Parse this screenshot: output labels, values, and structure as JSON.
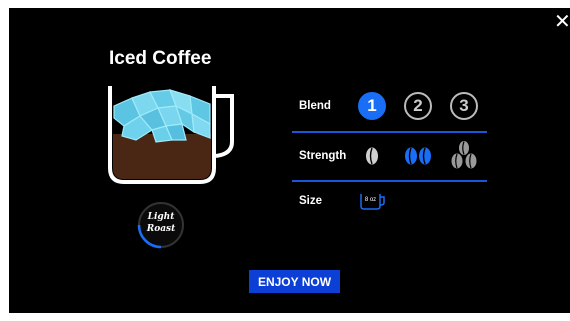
{
  "dialog": {
    "close_label": "✕",
    "title": "Iced Coffee",
    "roast_line1": "Light",
    "roast_line2": "Roast"
  },
  "blend": {
    "label": "Blend",
    "options": [
      "1",
      "2",
      "3"
    ],
    "selected": "1"
  },
  "strength": {
    "label": "Strength",
    "options": [
      "bean-light-icon",
      "bean-medium-icon",
      "bean-strong-icon"
    ],
    "selected": 2
  },
  "size": {
    "label": "Size",
    "cup_label": "8 oz"
  },
  "actions": {
    "enjoy_label": "ENJOY NOW"
  },
  "colors": {
    "background": "#000000",
    "accent": "#1a6ef5",
    "button": "#0b3fd6",
    "coffee": "#4a2614",
    "ice": "#6ecfe8"
  }
}
